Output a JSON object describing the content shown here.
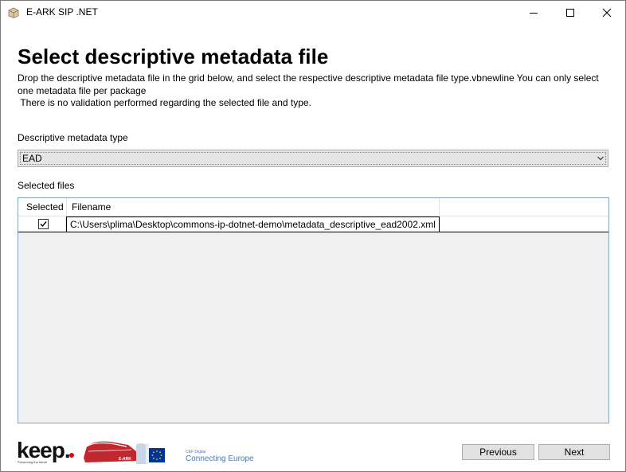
{
  "window": {
    "title": "E-ARK SIP .NET"
  },
  "page": {
    "heading": "Select descriptive metadata file",
    "description": "Drop the descriptive metadata file in the grid below, and select the respective descriptive metadata file type.vbnewline You can only select one metadata file per package\n There is no validation performed regarding the selected file and type."
  },
  "metadata_type": {
    "label": "Descriptive metadata type",
    "selected": "EAD"
  },
  "files": {
    "label": "Selected files",
    "columns": [
      "Selected",
      "Filename"
    ],
    "rows": [
      {
        "selected": true,
        "filename": "C:\\Users\\plima\\Desktop\\commons-ip-dotnet-demo\\metadata_descriptive_ead2002.xml"
      }
    ]
  },
  "logos": {
    "keep_word": "keep.",
    "keep_tagline": "Preserving the future",
    "eark_text": "E-ARK",
    "cef_small": "CEF Digital",
    "cef_big": "Connecting Europe"
  },
  "buttons": {
    "previous": "Previous",
    "next": "Next"
  },
  "colors": {
    "keep_red": "#e30613",
    "eark_red": "#c0282d",
    "eu_blue": "#003399",
    "eu_gold": "#ffcc00",
    "cef_text": "#4a78b5",
    "grid_border": "#82a4c4"
  }
}
